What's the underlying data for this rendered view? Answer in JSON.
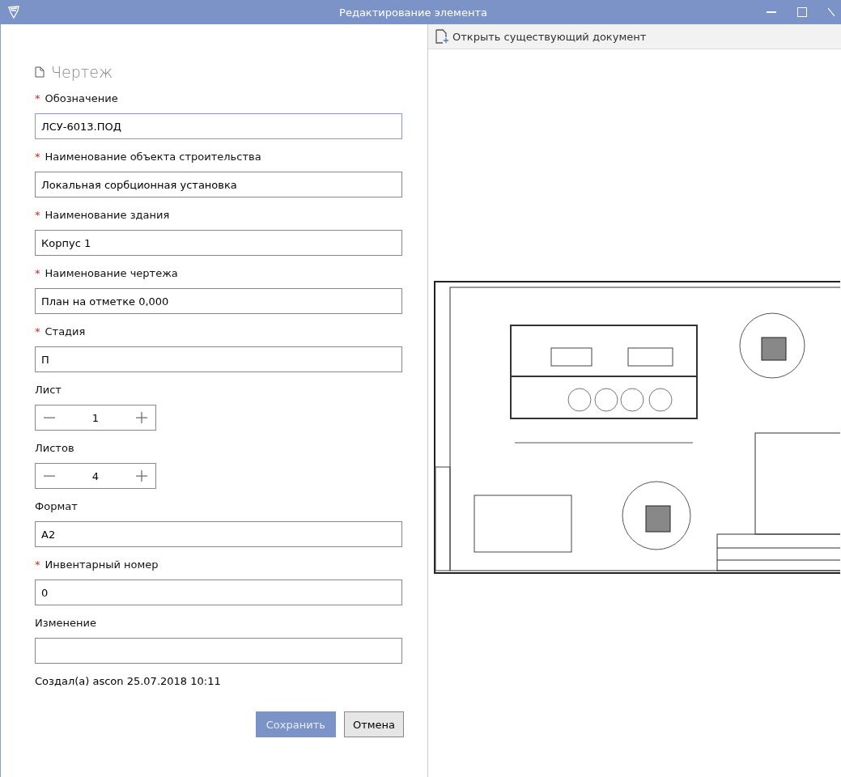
{
  "window": {
    "title": "Редактирование элемента"
  },
  "form": {
    "heading": "Чертеж",
    "fields": [
      {
        "kind": "text",
        "label": "Обозначение",
        "marker": "*",
        "value": "ЛСУ-6013.ПОД"
      },
      {
        "kind": "text",
        "label": "Наименование объекта строительства",
        "marker": "*",
        "value": "Локальная сорбционная установка"
      },
      {
        "kind": "text",
        "label": "Наименование здания",
        "marker": "*",
        "value": "Корпус 1"
      },
      {
        "kind": "text",
        "label": "Наименование чертежа",
        "marker": "*",
        "value": "План на отметке 0,000"
      },
      {
        "kind": "text",
        "label": "Стадия",
        "marker": "*",
        "value": "П"
      },
      {
        "kind": "stepper",
        "label": "Лист",
        "value": "1"
      },
      {
        "kind": "stepper",
        "label": "Листов",
        "value": "4"
      },
      {
        "kind": "text",
        "label": "Формат",
        "value": "А2"
      },
      {
        "kind": "text",
        "label": "Инвентарный номер",
        "marker": "*",
        "value": "0"
      },
      {
        "kind": "text",
        "label": "Изменение"
      }
    ],
    "created": "Создал(а) ascon 25.07.2018 10:11",
    "buttons": [
      {
        "label": "Сохранить",
        "kind": "primary"
      },
      {
        "label": "Отмена",
        "kind": "secondary"
      }
    ]
  },
  "preview": {
    "open_button": "Открыть существующий документ"
  }
}
